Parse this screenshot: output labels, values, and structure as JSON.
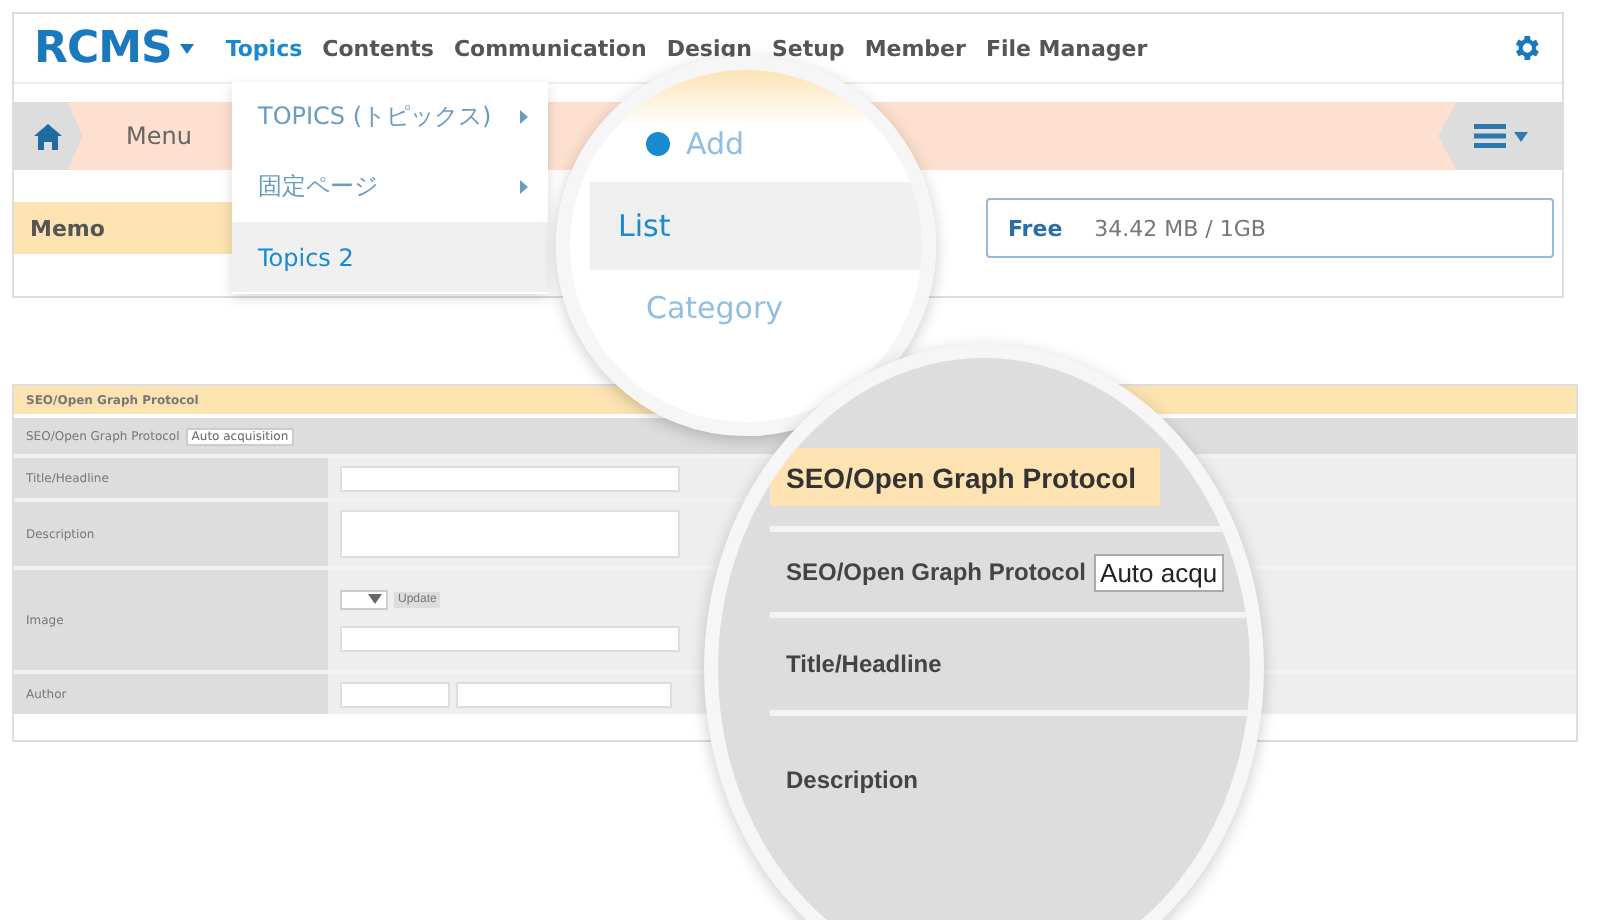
{
  "header": {
    "logo": "RCMS",
    "nav": [
      {
        "label": "Topics",
        "selected": true
      },
      {
        "label": "Contents",
        "selected": false
      },
      {
        "label": "Communication",
        "selected": false
      },
      {
        "label": "Design",
        "selected": false
      },
      {
        "label": "Setup",
        "selected": false
      },
      {
        "label": "Member",
        "selected": false
      },
      {
        "label": "File Manager",
        "selected": false
      }
    ]
  },
  "topics_menu": {
    "items": [
      {
        "label": "TOPICS (トピックス)",
        "has_submenu": true,
        "selected": false
      },
      {
        "label": "固定ページ",
        "has_submenu": true,
        "selected": false
      },
      {
        "label": "Topics 2",
        "has_submenu": false,
        "selected": true
      }
    ]
  },
  "breadcrumb": {
    "items": [
      "Menu"
    ]
  },
  "memo": {
    "title": "Memo"
  },
  "storage": {
    "label": "Free",
    "value": "34.42 MB / 1GB"
  },
  "magnifier_menu": {
    "items": [
      {
        "label": "Add",
        "kind": "add",
        "selected": false
      },
      {
        "label": "List",
        "kind": "link",
        "selected": true
      },
      {
        "label": "Category",
        "kind": "link",
        "selected": false
      }
    ]
  },
  "seo_panel": {
    "title": "SEO/Open Graph Protocol",
    "rows": [
      {
        "kind": "select",
        "label": "SEO/Open Graph Protocol",
        "value": "Auto acquisition"
      },
      {
        "kind": "text",
        "label": "Title/Headline"
      },
      {
        "kind": "textarea",
        "label": "Description"
      },
      {
        "kind": "image",
        "label": "Image",
        "button": "Update"
      },
      {
        "kind": "author",
        "label": "Author"
      }
    ]
  },
  "seo_magnifier": {
    "title": "SEO/Open Graph Protocol",
    "rows": [
      {
        "kind": "select",
        "label": "SEO/Open Graph Protocol",
        "value": "Auto acqu"
      },
      {
        "kind": "text",
        "label": "Title/Headline"
      },
      {
        "kind": "textarea",
        "label": "Description"
      }
    ]
  }
}
